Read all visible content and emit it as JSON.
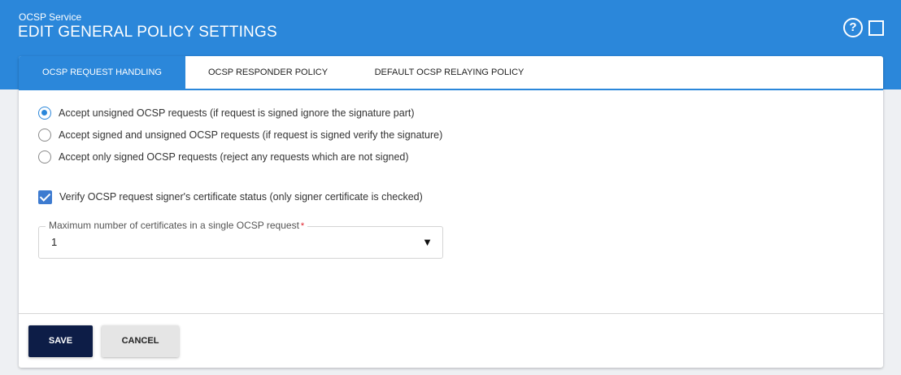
{
  "header": {
    "subtitle": "OCSP Service",
    "title": "EDIT GENERAL POLICY SETTINGS",
    "help_icon": "?",
    "background_color": "#2b87da"
  },
  "tabs": [
    {
      "label": "OCSP REQUEST HANDLING",
      "active": true
    },
    {
      "label": "OCSP RESPONDER POLICY",
      "active": false
    },
    {
      "label": "DEFAULT OCSP RELAYING POLICY",
      "active": false
    }
  ],
  "request_options": [
    {
      "label": "Accept unsigned OCSP requests (if request is signed ignore the signature part)",
      "selected": true
    },
    {
      "label": "Accept signed and unsigned OCSP requests (if request is signed verify the signature)",
      "selected": false
    },
    {
      "label": "Accept only signed OCSP requests (reject any requests which are not signed)",
      "selected": false
    }
  ],
  "verify_checkbox": {
    "label": "Verify OCSP request signer's certificate status (only signer certificate is checked)",
    "checked": true
  },
  "max_certificates": {
    "label": "Maximum number of certificates in a single OCSP request",
    "required_marker": "*",
    "value": "1",
    "arrow": "▼"
  },
  "buttons": {
    "save_label": "SAVE",
    "cancel_label": "CANCEL",
    "save_color": "#0d1d47"
  }
}
